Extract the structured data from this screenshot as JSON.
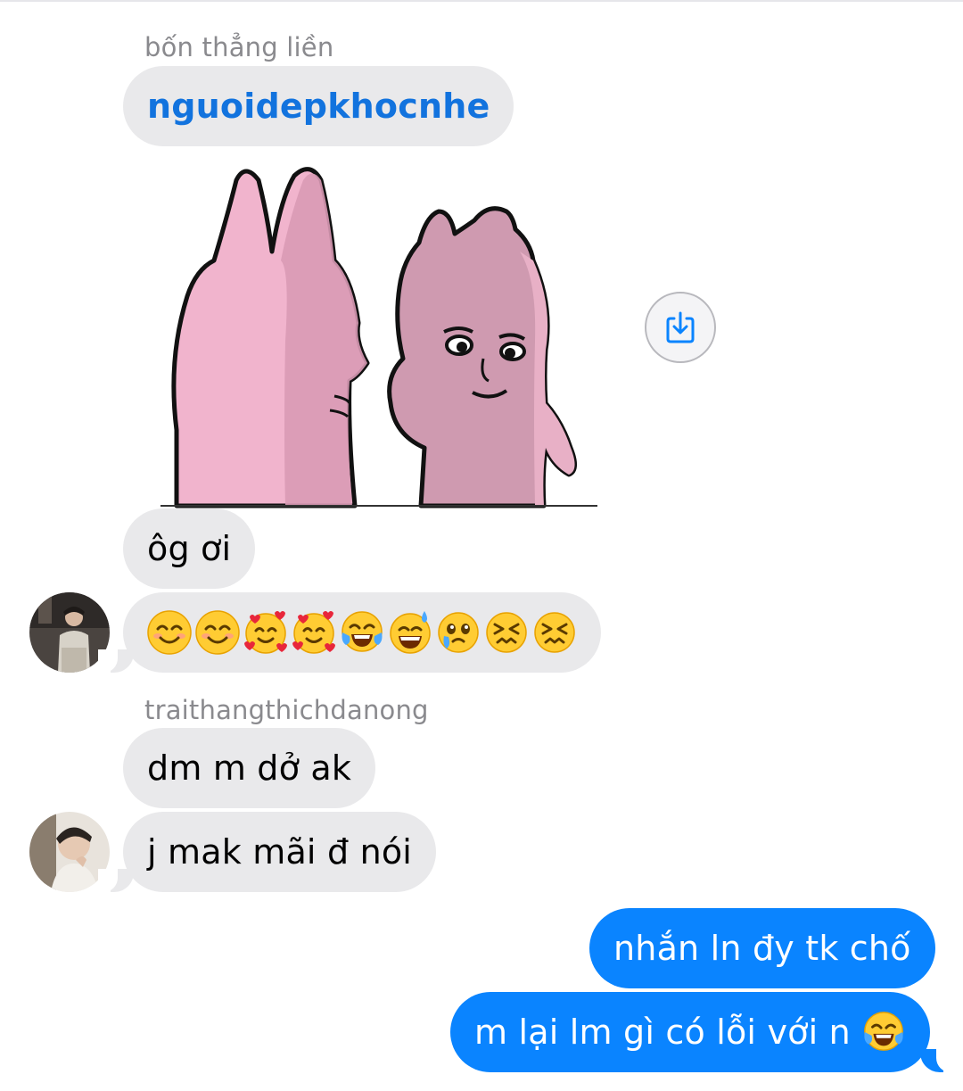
{
  "conversation": {
    "group1": {
      "sender": "bốn thẳng liền",
      "mention": "nguoidepkhocnhe",
      "sticker_icon": "pink-rabbit-sticker",
      "save_icon": "save-to-device-icon",
      "message": "ôg ơi",
      "emojis": [
        "smiling-face-icon",
        "smiling-face-icon",
        "smiling-face-with-hearts-icon",
        "smiling-face-with-hearts-icon",
        "face-with-tears-of-joy-icon",
        "grinning-face-with-sweat-icon",
        "face-holding-back-tears-icon",
        "confounded-face-icon",
        "confounded-face-icon"
      ]
    },
    "group2": {
      "sender": "traithangthichdanong",
      "messages": [
        "dm m dở ak",
        "j mak mãi đ nói"
      ]
    },
    "outgoing": {
      "messages": [
        "nhắn ln đy tk chố",
        "m lại lm gì có lỗi với n"
      ],
      "trailing_emoji": "face-with-tears-of-joy-icon"
    }
  },
  "colors": {
    "incoming_bubble": "#e9e9eb",
    "outgoing_bubble": "#0a84ff",
    "mention": "#1273de",
    "sender_label": "#8a8a8e"
  }
}
